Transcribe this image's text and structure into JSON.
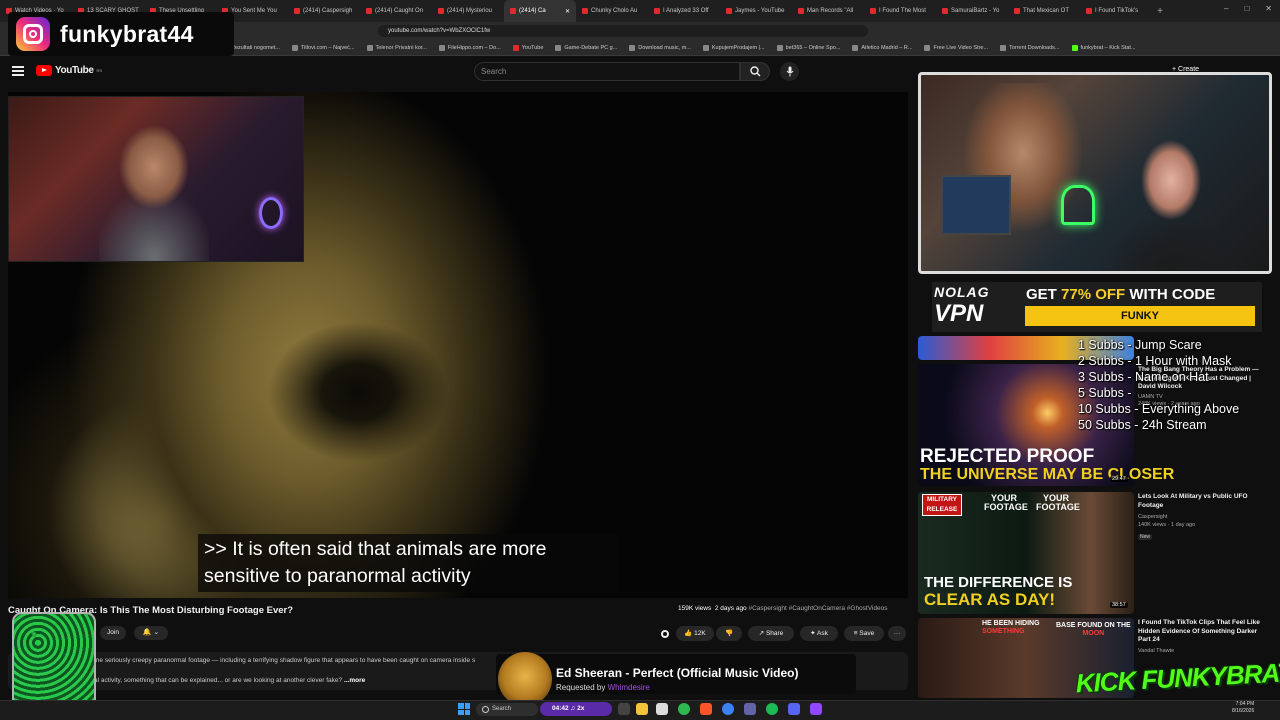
{
  "browser": {
    "tabs": [
      {
        "label": "Watch Videos · Yo",
        "active": false
      },
      {
        "label": "13 SCARY GHOST",
        "active": false
      },
      {
        "label": "These Unsettling",
        "active": false
      },
      {
        "label": "You Sent Me You",
        "active": false
      },
      {
        "label": "(2414) Caspersigh",
        "active": false
      },
      {
        "label": "(2414) Caught On",
        "active": false
      },
      {
        "label": "(2414) Mysteriou",
        "active": false
      },
      {
        "label": "(2414) Ca",
        "active": true
      },
      {
        "label": "Chunky Cholo Au",
        "active": false
      },
      {
        "label": "I Analyzed 33 Off",
        "active": false
      },
      {
        "label": "Jaymes - YouTube",
        "active": false
      },
      {
        "label": "Man Records \"All",
        "active": false
      },
      {
        "label": "I Found The Most",
        "active": false
      },
      {
        "label": "SamuraiBartz - Yo",
        "active": false
      },
      {
        "label": "That Mexican OT",
        "active": false
      },
      {
        "label": "I Found TikTok's",
        "active": false
      }
    ],
    "new_tab": "+",
    "window_controls": [
      "–",
      "□",
      "✕"
    ],
    "url": "youtube.com/watch?v=WbZXOClC1fw",
    "bookmarks": [
      "Rezultati nogomet...",
      "Titlovi.com – Najveć...",
      "Telenor Privatni kor...",
      "FileHippo.com – Do...",
      "YouTube",
      "Game-Debate PC g...",
      "Download music, m...",
      "KupujemProdajem |...",
      "bet365 – Online Spo...",
      "Atletico Madrid – R...",
      "Free Live Video Stre...",
      "Torrent Downloads...",
      "funkybrat – Kick Stat..."
    ]
  },
  "overlay": {
    "instagram_handle": "funkybrat44",
    "sub_goals": [
      "1 Subbs - Jump Scare",
      "2 Subbs - 1 Hour with Mask",
      "3 Subbs - Name on Hat",
      "5 Subbs -",
      "10 Subbs - Everything Above",
      "50 Subbs - 24h Stream"
    ],
    "kick_logo": "KICK FUNKYBRAT"
  },
  "youtube": {
    "logo_text": "YouTube",
    "logo_region": "RS",
    "search_placeholder": "Search",
    "create_label": "+ Create",
    "caption_line1": ">> It is often said that animals are more",
    "caption_line2": "sensitive to paranormal activity",
    "video_title": "Caught On Camera: Is This The Most Disturbing Footage Ever?",
    "views": "159K views",
    "age": "2 days ago",
    "hashtags": "#Caspersight #CaughtOnCamera #GhostVideos",
    "join_label": "Join",
    "bell_label": "🔔 ⌄",
    "like_label": "👍 12K",
    "dislike_label": "👎",
    "share_label": "↗ Share",
    "ask_label": "✦ Ask",
    "save_label": "≡ Save",
    "more_label": "···",
    "desc_line1": "me seriously creepy paranormal footage — including a terrifying shadow figure that appears to have been caught on camera inside s",
    "desc_line2": "al activity, something that can be explained... or are we looking at another clever fake?",
    "desc_more": "...more"
  },
  "ad": {
    "logo_top": "NOLAG",
    "logo_bottom": "VPN",
    "offer_prefix": "GET ",
    "offer_pct": "77% OFF",
    "offer_suffix": " WITH CODE",
    "code": "FUNKY"
  },
  "sidebar": {
    "videos": [
      {
        "title": "The Big Bang Theory Has a Problem — Everything We Know Just Changed | David Wilcock",
        "channel": "UAMN TV",
        "meta": "248K views · 2 years ago",
        "duration": "29:47",
        "thumb_line1": "REJECTED PROOF",
        "thumb_line2": "THE UNIVERSE MAY BE CLOSER"
      },
      {
        "title": "Lets Look At Military vs Public UFO Footage",
        "channel": "Caspersight",
        "meta": "140K views · 1 day ago",
        "badge": "New",
        "duration": "38:57",
        "label_military": "MILITARY RELEASE",
        "label_yours1": "YOUR FOOTAGE",
        "label_yours2": "YOUR FOOTAGE",
        "thumb_line1": "THE DIFFERENCE IS",
        "thumb_line2": "CLEAR AS DAY!"
      },
      {
        "title": "I Found The TikTok Clips That Feel Like Hidden Evidence Of Something Darker Part 24",
        "channel": "Vandal Thawte",
        "meta": "",
        "t1a": "HE BEEN HIDING",
        "t1b": "SOMETHING",
        "t2a": "BASE FOUND ON THE",
        "t2b": "MOON"
      }
    ]
  },
  "music": {
    "title": "Ed Sheeran - Perfect (Official Music Video)",
    "requested_prefix": "Requested by ",
    "requested_user": "Whimdesire"
  },
  "taskbar": {
    "search_label": "Search",
    "media_label": "04:42 ♫ 2x",
    "clock_time": "7:04 PM",
    "clock_date": "8/16/2026"
  },
  "colors": {
    "brand_red": "#ff0000",
    "kick_green": "#53fc18",
    "ad_yellow": "#f5c411",
    "requester_purple": "#a050e0"
  }
}
